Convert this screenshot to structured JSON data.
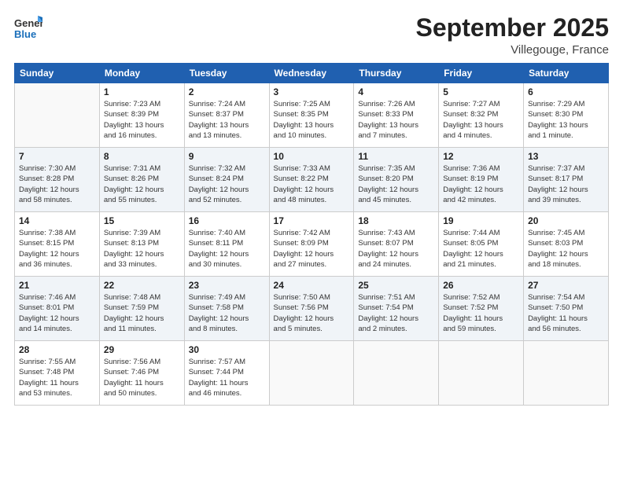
{
  "logo": {
    "line1": "General",
    "line2": "Blue"
  },
  "title": "September 2025",
  "location": "Villegouge, France",
  "weekdays": [
    "Sunday",
    "Monday",
    "Tuesday",
    "Wednesday",
    "Thursday",
    "Friday",
    "Saturday"
  ],
  "weeks": [
    [
      {
        "day": "",
        "content": ""
      },
      {
        "day": "1",
        "content": "Sunrise: 7:23 AM\nSunset: 8:39 PM\nDaylight: 13 hours\nand 16 minutes."
      },
      {
        "day": "2",
        "content": "Sunrise: 7:24 AM\nSunset: 8:37 PM\nDaylight: 13 hours\nand 13 minutes."
      },
      {
        "day": "3",
        "content": "Sunrise: 7:25 AM\nSunset: 8:35 PM\nDaylight: 13 hours\nand 10 minutes."
      },
      {
        "day": "4",
        "content": "Sunrise: 7:26 AM\nSunset: 8:33 PM\nDaylight: 13 hours\nand 7 minutes."
      },
      {
        "day": "5",
        "content": "Sunrise: 7:27 AM\nSunset: 8:32 PM\nDaylight: 13 hours\nand 4 minutes."
      },
      {
        "day": "6",
        "content": "Sunrise: 7:29 AM\nSunset: 8:30 PM\nDaylight: 13 hours\nand 1 minute."
      }
    ],
    [
      {
        "day": "7",
        "content": "Sunrise: 7:30 AM\nSunset: 8:28 PM\nDaylight: 12 hours\nand 58 minutes."
      },
      {
        "day": "8",
        "content": "Sunrise: 7:31 AM\nSunset: 8:26 PM\nDaylight: 12 hours\nand 55 minutes."
      },
      {
        "day": "9",
        "content": "Sunrise: 7:32 AM\nSunset: 8:24 PM\nDaylight: 12 hours\nand 52 minutes."
      },
      {
        "day": "10",
        "content": "Sunrise: 7:33 AM\nSunset: 8:22 PM\nDaylight: 12 hours\nand 48 minutes."
      },
      {
        "day": "11",
        "content": "Sunrise: 7:35 AM\nSunset: 8:20 PM\nDaylight: 12 hours\nand 45 minutes."
      },
      {
        "day": "12",
        "content": "Sunrise: 7:36 AM\nSunset: 8:19 PM\nDaylight: 12 hours\nand 42 minutes."
      },
      {
        "day": "13",
        "content": "Sunrise: 7:37 AM\nSunset: 8:17 PM\nDaylight: 12 hours\nand 39 minutes."
      }
    ],
    [
      {
        "day": "14",
        "content": "Sunrise: 7:38 AM\nSunset: 8:15 PM\nDaylight: 12 hours\nand 36 minutes."
      },
      {
        "day": "15",
        "content": "Sunrise: 7:39 AM\nSunset: 8:13 PM\nDaylight: 12 hours\nand 33 minutes."
      },
      {
        "day": "16",
        "content": "Sunrise: 7:40 AM\nSunset: 8:11 PM\nDaylight: 12 hours\nand 30 minutes."
      },
      {
        "day": "17",
        "content": "Sunrise: 7:42 AM\nSunset: 8:09 PM\nDaylight: 12 hours\nand 27 minutes."
      },
      {
        "day": "18",
        "content": "Sunrise: 7:43 AM\nSunset: 8:07 PM\nDaylight: 12 hours\nand 24 minutes."
      },
      {
        "day": "19",
        "content": "Sunrise: 7:44 AM\nSunset: 8:05 PM\nDaylight: 12 hours\nand 21 minutes."
      },
      {
        "day": "20",
        "content": "Sunrise: 7:45 AM\nSunset: 8:03 PM\nDaylight: 12 hours\nand 18 minutes."
      }
    ],
    [
      {
        "day": "21",
        "content": "Sunrise: 7:46 AM\nSunset: 8:01 PM\nDaylight: 12 hours\nand 14 minutes."
      },
      {
        "day": "22",
        "content": "Sunrise: 7:48 AM\nSunset: 7:59 PM\nDaylight: 12 hours\nand 11 minutes."
      },
      {
        "day": "23",
        "content": "Sunrise: 7:49 AM\nSunset: 7:58 PM\nDaylight: 12 hours\nand 8 minutes."
      },
      {
        "day": "24",
        "content": "Sunrise: 7:50 AM\nSunset: 7:56 PM\nDaylight: 12 hours\nand 5 minutes."
      },
      {
        "day": "25",
        "content": "Sunrise: 7:51 AM\nSunset: 7:54 PM\nDaylight: 12 hours\nand 2 minutes."
      },
      {
        "day": "26",
        "content": "Sunrise: 7:52 AM\nSunset: 7:52 PM\nDaylight: 11 hours\nand 59 minutes."
      },
      {
        "day": "27",
        "content": "Sunrise: 7:54 AM\nSunset: 7:50 PM\nDaylight: 11 hours\nand 56 minutes."
      }
    ],
    [
      {
        "day": "28",
        "content": "Sunrise: 7:55 AM\nSunset: 7:48 PM\nDaylight: 11 hours\nand 53 minutes."
      },
      {
        "day": "29",
        "content": "Sunrise: 7:56 AM\nSunset: 7:46 PM\nDaylight: 11 hours\nand 50 minutes."
      },
      {
        "day": "30",
        "content": "Sunrise: 7:57 AM\nSunset: 7:44 PM\nDaylight: 11 hours\nand 46 minutes."
      },
      {
        "day": "",
        "content": ""
      },
      {
        "day": "",
        "content": ""
      },
      {
        "day": "",
        "content": ""
      },
      {
        "day": "",
        "content": ""
      }
    ]
  ]
}
